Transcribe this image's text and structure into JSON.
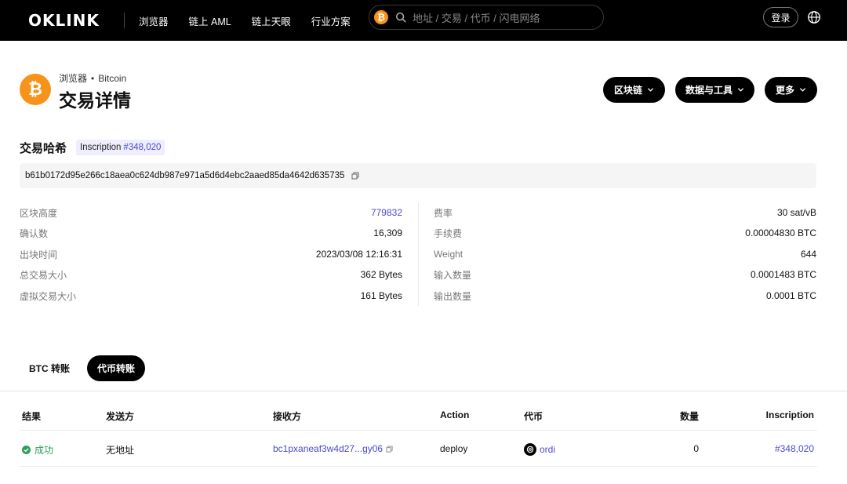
{
  "nav": {
    "logo": "OKLINK",
    "items": [
      "浏览器",
      "链上 AML",
      "链上天眼",
      "行业方案"
    ],
    "search_placeholder": "地址 / 交易 / 代币 / 闪电网络",
    "search_chain_icon": "₿",
    "login": "登录"
  },
  "header": {
    "crumb_root": "浏览器",
    "crumb_chain": "Bitcoin",
    "title": "交易详情",
    "coin_symbol": "₿",
    "buttons": [
      "区块链",
      "数据与工具",
      "更多"
    ]
  },
  "hash": {
    "label": "交易哈希",
    "inscription_prefix": "Inscription",
    "inscription_number": "#348,020",
    "value": "b61b0172d95e266c18aea0c624db987e971a5d6d4ebc2aaed85da4642d635735"
  },
  "details": {
    "left": [
      {
        "label": "区块高度",
        "value": "779832"
      },
      {
        "label": "确认数",
        "value": "16,309"
      },
      {
        "label": "出块时间",
        "value": "2023/03/08 12:16:31"
      },
      {
        "label": "总交易大小",
        "value": "362 Bytes"
      },
      {
        "label": "虚拟交易大小",
        "value": "161 Bytes"
      }
    ],
    "right": [
      {
        "label": "费率",
        "value": "30 sat/vB"
      },
      {
        "label": "手续费",
        "value": "0.00004830 BTC"
      },
      {
        "label": "Weight",
        "value": "644"
      },
      {
        "label": "输入数量",
        "value": "0.0001483 BTC"
      },
      {
        "label": "输出数量",
        "value": "0.0001 BTC"
      }
    ]
  },
  "tabs": [
    "BTC 转账",
    "代币转账"
  ],
  "active_tab": "代币转账",
  "table": {
    "headers": [
      "结果",
      "发送方",
      "接收方",
      "Action",
      "代币",
      "数量",
      "Inscription"
    ],
    "rows": [
      {
        "result": "成功",
        "sender": "无地址",
        "receiver": "bc1pxaneaf3w4d27...gy06",
        "action": "deploy",
        "token": "ordi",
        "amount": "0",
        "inscription": "#348,020"
      }
    ]
  },
  "colors": {
    "accent_link": "#4a4acc",
    "success": "#2f9e5a",
    "bitcoin": "#f7931a",
    "nav_bg": "#000000"
  }
}
